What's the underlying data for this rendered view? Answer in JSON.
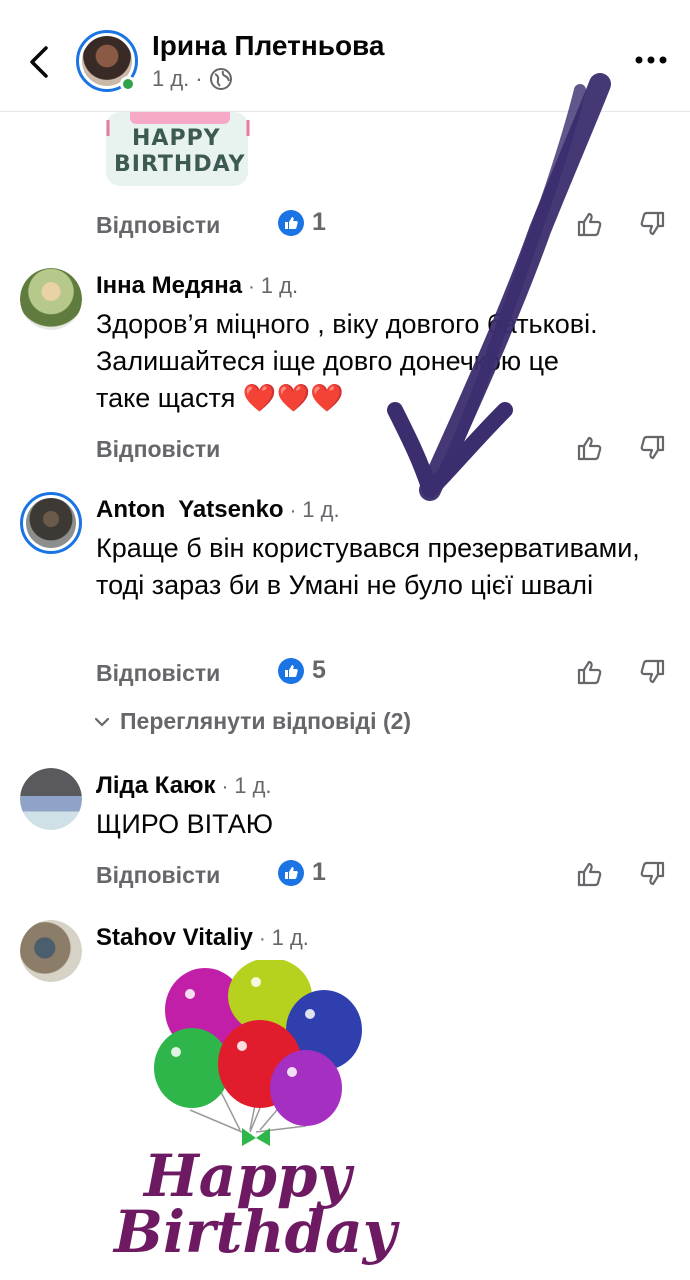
{
  "header": {
    "name": "Ірина Плетньова",
    "time": "1 д.",
    "dot": "·"
  },
  "sticker_top": {
    "line1": "HAPPY",
    "line2": "BIRTHDAY"
  },
  "reply_label": "Відповісти",
  "comments": [
    {
      "name": "",
      "time": "",
      "text": "",
      "likes": "1"
    },
    {
      "name": "Інна Медяна",
      "time": "1 д.",
      "text": "Здоров’я міцного , віку довгого батькові. Залишайтеся іще довго донечкою це таке щастя ❤️❤️❤️",
      "likes": ""
    },
    {
      "name": "Anton  Yatsenko",
      "time": "1 д.",
      "text": "Краще б він користувався презервативами, тоді зараз би в Умані не було цієї швалі",
      "likes": "5"
    },
    {
      "name": "Ліда Каюк",
      "time": "1 д.",
      "text": "ЩИРО ВІТАЮ",
      "likes": "1"
    },
    {
      "name": "Stahov Vitaliy",
      "time": "1 д.",
      "text": "",
      "likes": ""
    }
  ],
  "view_replies": "Переглянути відповіді (2)",
  "sticker_bottom": {
    "line1": "Happy",
    "line2": "Birthday"
  },
  "colors": {
    "accent": "#1b74e4",
    "muted": "#65676b",
    "online": "#31a24c",
    "annotation": "#3b2d6e"
  }
}
